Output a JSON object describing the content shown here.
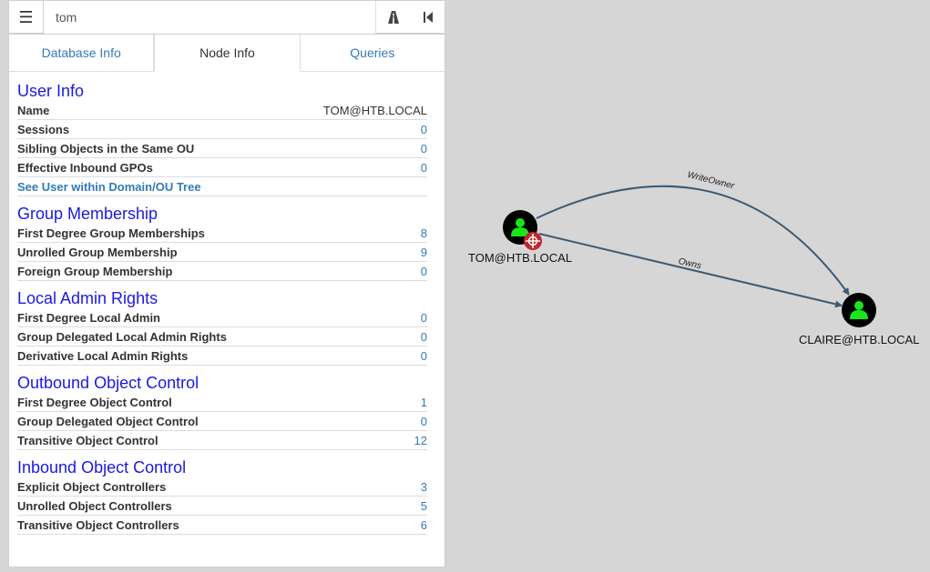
{
  "search": {
    "value": "tom"
  },
  "tabs": [
    {
      "label": "Database Info"
    },
    {
      "label": "Node Info"
    },
    {
      "label": "Queries"
    }
  ],
  "sections": {
    "user_info": {
      "title": "User Info",
      "name_label": "Name",
      "name_value": "TOM@HTB.LOCAL",
      "sessions_label": "Sessions",
      "sessions_value": "0",
      "sibling_label": "Sibling Objects in the Same OU",
      "sibling_value": "0",
      "gpo_label": "Effective Inbound GPOs",
      "gpo_value": "0",
      "tree_link": "See User within Domain/OU Tree"
    },
    "group_membership": {
      "title": "Group Membership",
      "first_label": "First Degree Group Memberships",
      "first_value": "8",
      "unrolled_label": "Unrolled Group Membership",
      "unrolled_value": "9",
      "foreign_label": "Foreign Group Membership",
      "foreign_value": "0"
    },
    "local_admin": {
      "title": "Local Admin Rights",
      "first_label": "First Degree Local Admin",
      "first_value": "0",
      "group_label": "Group Delegated Local Admin Rights",
      "group_value": "0",
      "deriv_label": "Derivative Local Admin Rights",
      "deriv_value": "0"
    },
    "outbound": {
      "title": "Outbound Object Control",
      "first_label": "First Degree Object Control",
      "first_value": "1",
      "group_label": "Group Delegated Object Control",
      "group_value": "0",
      "trans_label": "Transitive Object Control",
      "trans_value": "12"
    },
    "inbound": {
      "title": "Inbound Object Control",
      "explicit_label": "Explicit Object Controllers",
      "explicit_value": "3",
      "unrolled_label": "Unrolled Object Controllers",
      "unrolled_value": "5",
      "trans_label": "Transitive Object Controllers",
      "trans_value": "6"
    }
  },
  "graph": {
    "nodes": [
      {
        "id": "tom",
        "label": "TOM@HTB.LOCAL",
        "icon": "user-icon",
        "badge": "target-icon"
      },
      {
        "id": "claire",
        "label": "CLAIRE@HTB.LOCAL",
        "icon": "user-icon"
      }
    ],
    "edges": [
      {
        "from": "tom",
        "to": "claire",
        "label": "WriteOwner"
      },
      {
        "from": "tom",
        "to": "claire",
        "label": "Owns"
      }
    ],
    "colors": {
      "node_fill": "#000000",
      "user_icon": "#19e619",
      "badge": "#c0282d",
      "edge": "#3d5a73"
    }
  }
}
